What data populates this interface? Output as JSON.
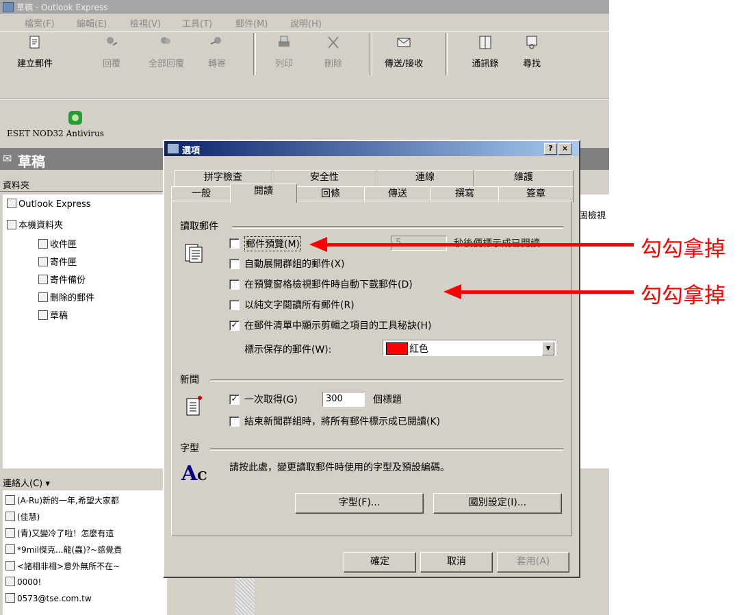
{
  "window": {
    "title": "草稿 - Outlook Express"
  },
  "menu": [
    "檔案(F)",
    "編輯(E)",
    "檢視(V)",
    "工具(T)",
    "郵件(M)",
    "說明(H)"
  ],
  "toolbar": {
    "buttons": [
      "建立郵件",
      "回覆",
      "全部回覆",
      "轉寄",
      "列印",
      "刪除",
      "傳送/接收",
      "通訊錄",
      "尋找"
    ],
    "addon": "ESET NOD32 Antivirus"
  },
  "folder_header": "草稿",
  "folders_label": "資料夾",
  "folder_tree": [
    "Outlook Express",
    "本機資料夾",
    "收件匣",
    "寄件匣",
    "寄件備份",
    "刪除的郵件",
    "草稿"
  ],
  "right_pane_text": "固檢視",
  "contacts": {
    "label": "連絡人(C) ▾",
    "items": [
      "(A-Ru)新的一年,希望大家都",
      "(佳慧)",
      "(青)又變冷了啦！怎麼有這",
      "*9mil傑克...龍(蟲)?~感覺貴",
      "<諸相非相>意外無所不在~",
      "0000!",
      "0573@tse.com.tw"
    ]
  },
  "dialog": {
    "title": "選項",
    "help_btn": "?",
    "close_btn": "×",
    "tabs_back": [
      "拼字檢查",
      "安全性",
      "連線",
      "維護"
    ],
    "tabs_front": [
      "一般",
      "閱讀",
      "回條",
      "傳送",
      "撰寫",
      "簽章"
    ],
    "read_section": "讀取郵件",
    "opt_preview": "郵件預覽(M)",
    "preview_seconds": "5",
    "preview_after": "秒後便標示成已閱讀",
    "opt_expand": "自動展開群組的郵件(X)",
    "opt_download": "在預覽窗格檢視郵件時自動下載郵件(D)",
    "opt_plaintext": "以純文字閱讀所有郵件(R)",
    "opt_tooltip": "在郵件清單中顯示剪輯之項目的工具秘訣(H)",
    "mark_label": "標示保存的郵件(W):",
    "mark_color_name": "紅色",
    "mark_color": "#ff0000",
    "news_section": "新聞",
    "opt_fetch": "一次取得(G)",
    "fetch_count": "300",
    "fetch_unit": "個標題",
    "opt_markread": "結束新聞群組時，將所有郵件標示成已閱讀(K)",
    "font_section": "字型",
    "font_desc": "請按此處，變更讀取郵件時使用的字型及預設編碼。",
    "btn_fonts": "字型(F)...",
    "btn_intl": "國別設定(I)...",
    "btn_ok": "確定",
    "btn_cancel": "取消",
    "btn_apply": "套用(A)"
  },
  "annotations": [
    "勾勾拿掉",
    "勾勾拿掉"
  ]
}
